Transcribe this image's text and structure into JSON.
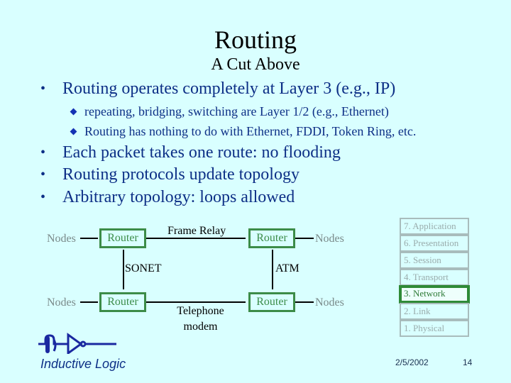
{
  "slide": {
    "title": "Routing",
    "subtitle": "A Cut Above",
    "bullets": [
      {
        "marker": "•",
        "text": "Routing operates completely at Layer 3 (e.g., IP)",
        "sub_bullets": [
          "repeating, bridging, switching are Layer 1/2 (e.g., Ethernet)",
          "Routing has nothing to do with Ethernet, FDDI, Token Ring, etc."
        ]
      },
      {
        "marker": "•",
        "text": "Each packet takes one route: no flooding"
      },
      {
        "marker": "•",
        "text": "Routing protocols update topology"
      },
      {
        "marker": "•",
        "text": "Arbitrary topology: loops allowed"
      }
    ]
  },
  "diagram": {
    "nodes_label": "Nodes",
    "router_label": "Router",
    "links": {
      "top": "Frame Relay",
      "left": "SONET",
      "right": "ATM",
      "bottom_line1": "Telephone",
      "bottom_line2": "modem"
    },
    "colors": {
      "router": "#3c8c48",
      "nodes": "#7a8a8a"
    }
  },
  "osi_stack": {
    "layers": [
      "7. Application",
      "6. Presentation",
      "5. Session",
      "4. Transport",
      "3. Network",
      "2. Link",
      "1. Physical"
    ],
    "highlighted": "3. Network"
  },
  "footer": {
    "logo_text": "Inductive Logic",
    "date": "2/5/2002",
    "page_number": "14"
  }
}
